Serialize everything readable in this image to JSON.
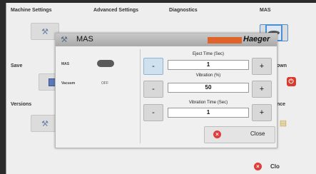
{
  "background": {
    "tabs": [
      "Machine Settings",
      "Advanced Settings",
      "Diagnostics",
      "MAS"
    ],
    "section_save": "Save",
    "section_versions": "Versions",
    "partial_shutdown": "own",
    "partial_maintenance": "nce",
    "close_label": "Clo"
  },
  "dialog": {
    "title": "MAS",
    "brand": "Haeger",
    "rows": [
      {
        "label": "MAS",
        "status": ""
      },
      {
        "label": "Vacuum",
        "status": "OFF"
      }
    ],
    "fields": [
      {
        "label": "Eject Time (Sec)",
        "value": "1"
      },
      {
        "label": "Vibration (%)",
        "value": "50"
      },
      {
        "label": "Vibration Time (Sec)",
        "value": "1"
      }
    ],
    "minus": "-",
    "plus": "+",
    "close_label": "Close"
  },
  "colors": {
    "brand_bar": "#e0632a",
    "close_icon": "#e23b3b",
    "accent": "#4a8fd6"
  },
  "icons": [
    "wrench-icon",
    "save-icon",
    "power-icon",
    "mas-icon",
    "close-icon"
  ]
}
